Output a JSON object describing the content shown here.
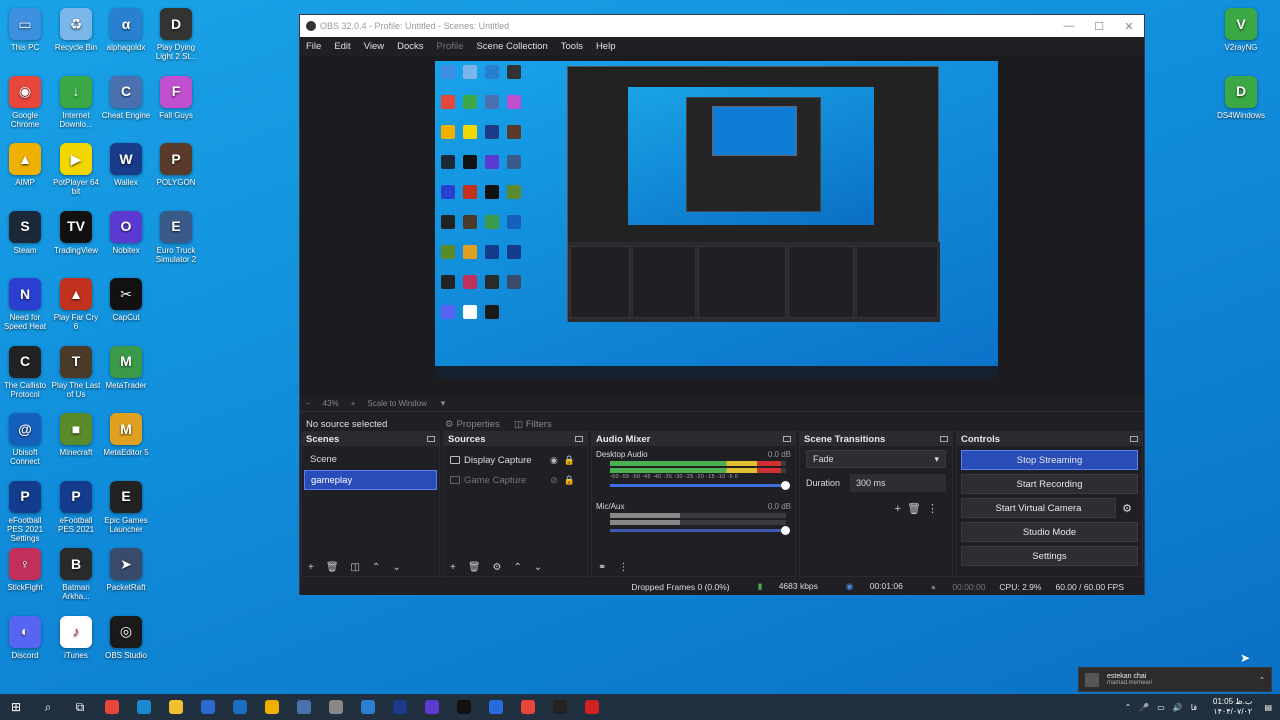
{
  "desktop": {
    "left_column": [
      {
        "label": "This PC",
        "color": "#3d8fe0",
        "glyph": "▭"
      },
      {
        "label": "Google Chrome",
        "color": "#e8463a",
        "glyph": "◉"
      },
      {
        "label": "AIMP",
        "color": "#f0b000",
        "glyph": "▲"
      },
      {
        "label": "Steam",
        "color": "#1b2838",
        "glyph": "S"
      },
      {
        "label": "Need for Speed Heat",
        "color": "#2a3fd0",
        "glyph": "N"
      },
      {
        "label": "The Callisto Protocol",
        "color": "#222222",
        "glyph": "C"
      },
      {
        "label": "Ubisoft Connect",
        "color": "#1560bd",
        "glyph": "@"
      },
      {
        "label": "eFootball PES 2021 Settings",
        "color": "#143c8c",
        "glyph": "P"
      },
      {
        "label": "StickFight",
        "color": "#c0305a",
        "glyph": "♀"
      },
      {
        "label": "Discord",
        "color": "#5865f2",
        "glyph": "◐"
      }
    ],
    "second_column": [
      {
        "label": "Recycle Bin",
        "color": "#7ab6e8",
        "glyph": "♻"
      },
      {
        "label": "Internet Downlo...",
        "color": "#3aa845",
        "glyph": "↓"
      },
      {
        "label": "PotPlayer 64 bit",
        "color": "#f2d600",
        "glyph": "▶"
      },
      {
        "label": "TradingView",
        "color": "#111111",
        "glyph": "TV"
      },
      {
        "label": "Play Far Cry 6",
        "color": "#c0311e",
        "glyph": "▲"
      },
      {
        "label": "Play The Last of Us",
        "color": "#4a3a2a",
        "glyph": "T"
      },
      {
        "label": "Minecraft",
        "color": "#5a8a2a",
        "glyph": "■"
      },
      {
        "label": "eFootball PES 2021",
        "color": "#143c8c",
        "glyph": "P"
      },
      {
        "label": "Batman Arkha...",
        "color": "#2a2a2a",
        "glyph": "B"
      },
      {
        "label": "iTunes",
        "color": "#ffffff",
        "glyph": "♪"
      }
    ],
    "third_column": [
      {
        "label": "alphagoldx",
        "color": "#2a80d0",
        "glyph": "α"
      },
      {
        "label": "Cheat Engine",
        "color": "#4a70b0",
        "glyph": "C"
      },
      {
        "label": "Wallex",
        "color": "#1a3a8a",
        "glyph": "W"
      },
      {
        "label": "Nobitex",
        "color": "#5a3ad0",
        "glyph": "O"
      },
      {
        "label": "CapCut",
        "color": "#111111",
        "glyph": "✂"
      },
      {
        "label": "MetaTrader",
        "color": "#3a9a4a",
        "glyph": "M"
      },
      {
        "label": "MetaEditor 5",
        "color": "#e0a020",
        "glyph": "M"
      },
      {
        "label": "Epic Games Launcher",
        "color": "#222222",
        "glyph": "E"
      },
      {
        "label": "PacketRaft",
        "color": "#3a4a6a",
        "glyph": "➤"
      },
      {
        "label": "OBS Studio",
        "color": "#1a1a1a",
        "glyph": "◎"
      }
    ],
    "fourth_column": [
      {
        "label": "Play Dying Light 2 St...",
        "color": "#333333",
        "glyph": "D"
      },
      {
        "label": "Fall Guys",
        "color": "#c050d0",
        "glyph": "F"
      },
      {
        "label": "POLYGON",
        "color": "#5a3a2a",
        "glyph": "P"
      },
      {
        "label": "Euro Truck Simulator 2",
        "color": "#3a5a8a",
        "glyph": "E"
      }
    ],
    "right_column": [
      {
        "label": "V2rayNG",
        "color": "#3aa845",
        "glyph": "V"
      },
      {
        "label": "DS4Windows",
        "color": "#3aa845",
        "glyph": "D"
      }
    ]
  },
  "obs": {
    "title": "OBS 32.0.4 - Profile: Untitled - Scenes: Untitled",
    "menu": [
      "File",
      "Edit",
      "View",
      "Docks",
      "Profile",
      "Scene Collection",
      "Tools",
      "Help"
    ],
    "zoom": {
      "minus": "−",
      "value": "43%",
      "plus": "+",
      "scale_label": "Scale to Window"
    },
    "source_toolbar": {
      "no_source": "No source selected",
      "properties": "Properties",
      "filters": "Filters"
    },
    "docks": {
      "scenes": {
        "title": "Scenes",
        "items": [
          {
            "label": "Scene",
            "selected": false
          },
          {
            "label": "gameplay",
            "selected": true
          }
        ]
      },
      "sources": {
        "title": "Sources",
        "items": [
          {
            "label": "Display Capture",
            "visible": true
          },
          {
            "label": "Game Capture",
            "visible": false
          }
        ]
      },
      "audio_mixer": {
        "title": "Audio Mixer",
        "channels": [
          {
            "name": "Desktop Audio",
            "db": "0.0 dB",
            "level": 0.97
          },
          {
            "name": "Mic/Aux",
            "db": "0.0 dB",
            "level": 0.4
          }
        ],
        "ticks": "-60 -55 -50 -45 -40 -35 -30 -25 -20 -15 -10 -5 0"
      },
      "scene_transitions": {
        "title": "Scene Transitions",
        "transition": "Fade",
        "duration_label": "Duration",
        "duration_value": "300 ms"
      },
      "controls": {
        "title": "Controls",
        "stop_streaming": "Stop Streaming",
        "start_recording": "Start Recording",
        "start_virtual_camera": "Start Virtual Camera",
        "studio_mode": "Studio Mode",
        "settings": "Settings"
      }
    },
    "status": {
      "dropped_frames": "Dropped Frames 0 (0.0%)",
      "bitrate": "4683 kbps",
      "stream_time": "00:01:06",
      "record_time": "00:00:00",
      "cpu": "CPU: 2.9%",
      "fps": "60.00 / 60.00 FPS"
    }
  },
  "toast": {
    "title": "estekan chai",
    "subtitle": "mamad.memeari"
  },
  "tray": {
    "time": "01:05 ب.ظ",
    "date": "۱۴۰۴/۰۷/۰۲",
    "lang": "فا"
  }
}
